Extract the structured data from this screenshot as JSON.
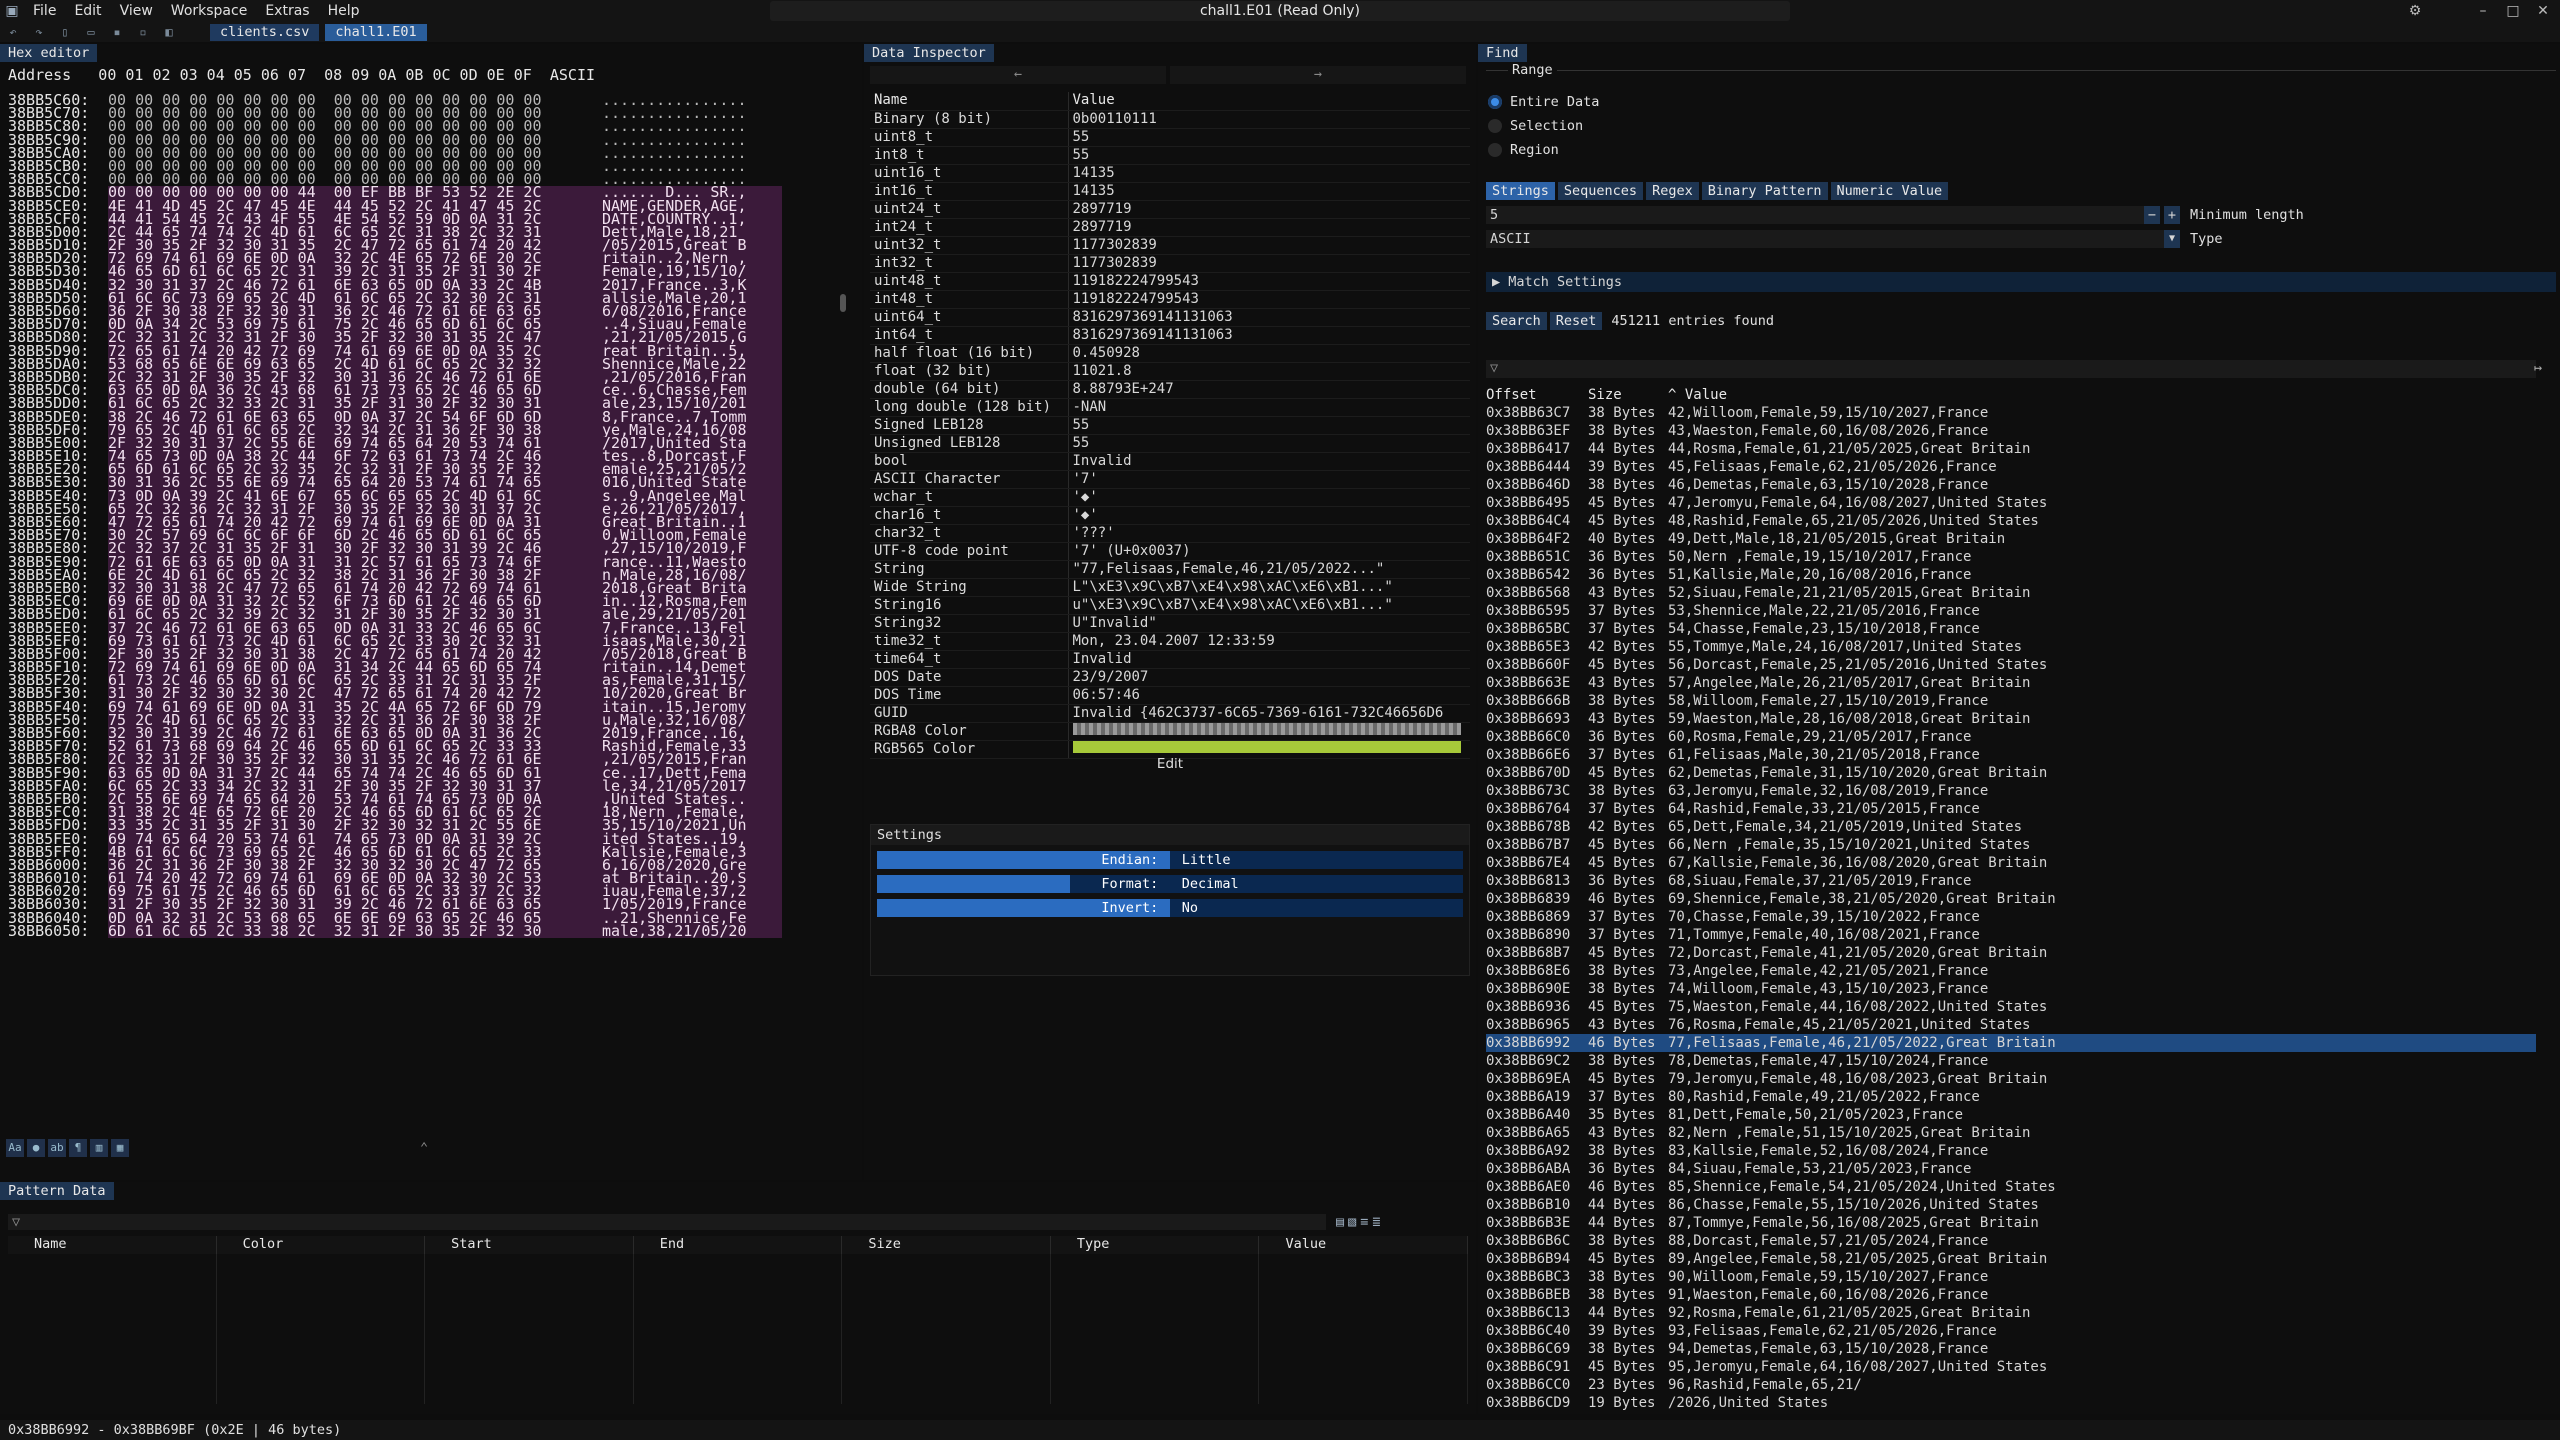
{
  "window": {
    "title": "chall1.E01 (Read Only)"
  },
  "menu": [
    "File",
    "Edit",
    "View",
    "Workspace",
    "Extras",
    "Help"
  ],
  "files": [
    "clients.csv",
    "chall1.E01"
  ],
  "hex_editor": {
    "tab": "Hex editor",
    "header": "Address   00 01 02 03 04 05 06 07  08 09 0A 0B 0C 0D 0E 0F  ASCII",
    "rows": [
      [
        "38BB5C60:",
        "00 00 00 00 00 00 00 00  00 00 00 00 00 00 00 00",
        "................"
      ],
      [
        "38BB5C70:",
        "00 00 00 00 00 00 00 00  00 00 00 00 00 00 00 00",
        "................"
      ],
      [
        "38BB5C80:",
        "00 00 00 00 00 00 00 00  00 00 00 00 00 00 00 00",
        "................"
      ],
      [
        "38BB5C90:",
        "00 00 00 00 00 00 00 00  00 00 00 00 00 00 00 00",
        "................"
      ],
      [
        "38BB5CA0:",
        "00 00 00 00 00 00 00 00  00 00 00 00 00 00 00 00",
        "................"
      ],
      [
        "38BB5CB0:",
        "00 00 00 00 00 00 00 00  00 00 00 00 00 00 00 00",
        "................"
      ],
      [
        "38BB5CC0:",
        "00 00 00 00 00 00 00 00  00 00 00 00 00 00 00 00",
        "................"
      ],
      [
        "38BB5CD0:",
        "00 00 00 00 00 00 00 44  00 EF BB BF 53 52 2E 2C",
        "...... D... SR.,"
      ],
      [
        "38BB5CE0:",
        "4E 41 4D 45 2C 47 45 4E  44 45 52 2C 41 47 45 2C",
        "NAME,GENDER,AGE,"
      ],
      [
        "38BB5CF0:",
        "44 41 54 45 2C 43 4F 55  4E 54 52 59 0D 0A 31 2C",
        "DATE,COUNTRY..1,"
      ],
      [
        "38BB5D00:",
        "2C 44 65 74 74 2C 4D 61  6C 65 2C 31 38 2C 32 31",
        "Dett,Male,18,21"
      ],
      [
        "38BB5D10:",
        "2F 30 35 2F 32 30 31 35  2C 47 72 65 61 74 20 42",
        "/05/2015,Great B"
      ],
      [
        "38BB5D20:",
        "72 69 74 61 69 6E 0D 0A  32 2C 4E 65 72 6E 20 2C",
        "ritain..2,Nern ,"
      ],
      [
        "38BB5D30:",
        "46 65 6D 61 6C 65 2C 31  39 2C 31 35 2F 31 30 2F",
        "Female,19,15/10/"
      ],
      [
        "38BB5D40:",
        "32 30 31 37 2C 46 72 61  6E 63 65 0D 0A 33 2C 4B",
        "2017,France..3,K"
      ],
      [
        "38BB5D50:",
        "61 6C 6C 73 69 65 2C 4D  61 6C 65 2C 32 30 2C 31",
        "allsie,Male,20,1"
      ],
      [
        "38BB5D60:",
        "36 2F 30 38 2F 32 30 31  36 2C 46 72 61 6E 63 65",
        "6/08/2016,France"
      ],
      [
        "38BB5D70:",
        "0D 0A 34 2C 53 69 75 61  75 2C 46 65 6D 61 6C 65",
        "..4,Siuau,Female"
      ],
      [
        "38BB5D80:",
        "2C 32 31 2C 32 31 2F 30  35 2F 32 30 31 35 2C 47",
        ",21,21/05/2015,G"
      ],
      [
        "38BB5D90:",
        "72 65 61 74 20 42 72 69  74 61 69 6E 0D 0A 35 2C",
        "reat Britain..5,"
      ],
      [
        "38BB5DA0:",
        "53 68 65 6E 6E 69 63 65  2C 4D 61 6C 65 2C 32 32",
        "Shennice,Male,22"
      ],
      [
        "38BB5DB0:",
        "2C 32 31 2F 30 35 2F 32  30 31 36 2C 46 72 61 6E",
        ",21/05/2016,Fran"
      ],
      [
        "38BB5DC0:",
        "63 65 0D 0A 36 2C 43 68  61 73 73 65 2C 46 65 6D",
        "ce..6,Chasse,Fem"
      ],
      [
        "38BB5DD0:",
        "61 6C 65 2C 32 33 2C 31  35 2F 31 30 2F 32 30 31",
        "ale,23,15/10/201"
      ],
      [
        "38BB5DE0:",
        "38 2C 46 72 61 6E 63 65  0D 0A 37 2C 54 6F 6D 6D",
        "8,France..7,Tomm"
      ],
      [
        "38BB5DF0:",
        "79 65 2C 4D 61 6C 65 2C  32 34 2C 31 36 2F 30 38",
        "ye,Male,24,16/08"
      ],
      [
        "38BB5E00:",
        "2F 32 30 31 37 2C 55 6E  69 74 65 64 20 53 74 61",
        "/2017,United Sta"
      ],
      [
        "38BB5E10:",
        "74 65 73 0D 0A 38 2C 44  6F 72 63 61 73 74 2C 46",
        "tes..8,Dorcast,F"
      ],
      [
        "38BB5E20:",
        "65 6D 61 6C 65 2C 32 35  2C 32 31 2F 30 35 2F 32",
        "emale,25,21/05/2"
      ],
      [
        "38BB5E30:",
        "30 31 36 2C 55 6E 69 74  65 64 20 53 74 61 74 65",
        "016,United State"
      ],
      [
        "38BB5E40:",
        "73 0D 0A 39 2C 41 6E 67  65 6C 65 65 2C 4D 61 6C",
        "s..9,Angelee,Mal"
      ],
      [
        "38BB5E50:",
        "65 2C 32 36 2C 32 31 2F  30 35 2F 32 30 31 37 2C",
        "e,26,21/05/2017,"
      ],
      [
        "38BB5E60:",
        "47 72 65 61 74 20 42 72  69 74 61 69 6E 0D 0A 31",
        "Great Britain..1"
      ],
      [
        "38BB5E70:",
        "30 2C 57 69 6C 6C 6F 6F  6D 2C 46 65 6D 61 6C 65",
        "0,Willoom,Female"
      ],
      [
        "38BB5E80:",
        "2C 32 37 2C 31 35 2F 31  30 2F 32 30 31 39 2C 46",
        ",27,15/10/2019,F"
      ],
      [
        "38BB5E90:",
        "72 61 6E 63 65 0D 0A 31  31 2C 57 61 65 73 74 6F",
        "rance..11,Waesto"
      ],
      [
        "38BB5EA0:",
        "6E 2C 4D 61 6C 65 2C 32  38 2C 31 36 2F 30 38 2F",
        "n,Male,28,16/08/"
      ],
      [
        "38BB5EB0:",
        "32 30 31 38 2C 47 72 65  61 74 20 42 72 69 74 61",
        "2018,Great Brita"
      ],
      [
        "38BB5EC0:",
        "69 6E 0D 0A 31 32 2C 52  6F 73 6D 61 2C 46 65 6D",
        "in..12,Rosma,Fem"
      ],
      [
        "38BB5ED0:",
        "61 6C 65 2C 32 39 2C 32  31 2F 30 35 2F 32 30 31",
        "ale,29,21/05/201"
      ],
      [
        "38BB5EE0:",
        "37 2C 46 72 61 6E 63 65  0D 0A 31 33 2C 46 65 6C",
        "7,France..13,Fel"
      ],
      [
        "38BB5EF0:",
        "69 73 61 61 73 2C 4D 61  6C 65 2C 33 30 2C 32 31",
        "isaas,Male,30,21"
      ],
      [
        "38BB5F00:",
        "2F 30 35 2F 32 30 31 38  2C 47 72 65 61 74 20 42",
        "/05/2018,Great B"
      ],
      [
        "38BB5F10:",
        "72 69 74 61 69 6E 0D 0A  31 34 2C 44 65 6D 65 74",
        "ritain..14,Demet"
      ],
      [
        "38BB5F20:",
        "61 73 2C 46 65 6D 61 6C  65 2C 33 31 2C 31 35 2F",
        "as,Female,31,15/"
      ],
      [
        "38BB5F30:",
        "31 30 2F 32 30 32 30 2C  47 72 65 61 74 20 42 72",
        "10/2020,Great Br"
      ],
      [
        "38BB5F40:",
        "69 74 61 69 6E 0D 0A 31  35 2C 4A 65 72 6F 6D 79",
        "itain..15,Jeromy"
      ],
      [
        "38BB5F50:",
        "75 2C 4D 61 6C 65 2C 33  32 2C 31 36 2F 30 38 2F",
        "u,Male,32,16/08/"
      ],
      [
        "38BB5F60:",
        "32 30 31 39 2C 46 72 61  6E 63 65 0D 0A 31 36 2C",
        "2019,France..16,"
      ],
      [
        "38BB5F70:",
        "52 61 73 68 69 64 2C 46  65 6D 61 6C 65 2C 33 33",
        "Rashid,Female,33"
      ],
      [
        "38BB5F80:",
        "2C 32 31 2F 30 35 2F 32  30 31 35 2C 46 72 61 6E",
        ",21/05/2015,Fran"
      ],
      [
        "38BB5F90:",
        "63 65 0D 0A 31 37 2C 44  65 74 74 2C 46 65 6D 61",
        "ce..17,Dett,Fema"
      ],
      [
        "38BB5FA0:",
        "6C 65 2C 33 34 2C 32 31  2F 30 35 2F 32 30 31 37",
        "le,34,21/05/2017"
      ],
      [
        "38BB5FB0:",
        "2C 55 6E 69 74 65 64 20  53 74 61 74 65 73 0D 0A",
        ",United States.."
      ],
      [
        "38BB5FC0:",
        "31 38 2C 4E 65 72 6E 20  2C 46 65 6D 61 6C 65 2C",
        "18,Nern ,Female,"
      ],
      [
        "38BB5FD0:",
        "33 35 2C 31 35 2F 31 30  2F 32 30 32 31 2C 55 6E",
        "35,15/10/2021,Un"
      ],
      [
        "38BB5FE0:",
        "69 74 65 64 20 53 74 61  74 65 73 0D 0A 31 39 2C",
        "ited States..19,"
      ],
      [
        "38BB5FF0:",
        "4B 61 6C 6C 73 69 65 2C  46 65 6D 61 6C 65 2C 33",
        "Kallsie,Female,3"
      ],
      [
        "38BB6000:",
        "36 2C 31 36 2F 30 38 2F  32 30 32 30 2C 47 72 65",
        "6,16/08/2020,Gre"
      ],
      [
        "38BB6010:",
        "61 74 20 42 72 69 74 61  69 6E 0D 0A 32 30 2C 53",
        "at Britain..20,S"
      ],
      [
        "38BB6020:",
        "69 75 61 75 2C 46 65 6D  61 6C 65 2C 33 37 2C 32",
        "iuau,Female,37,2"
      ],
      [
        "38BB6030:",
        "31 2F 30 35 2F 32 30 31  39 2C 46 72 61 6E 63 65",
        "1/05/2019,France"
      ],
      [
        "38BB6040:",
        "0D 0A 32 31 2C 53 68 65  6E 6E 69 63 65 2C 46 65",
        "..21,Shennice,Fe"
      ],
      [
        "38BB6050:",
        "6D 61 6C 65 2C 33 38 2C  32 31 2F 30 35 2F 32 30",
        "male,38,21/05/20"
      ]
    ]
  },
  "data_inspector": {
    "tab": "Data Inspector",
    "nav": [
      "←",
      "→"
    ],
    "header": [
      "Name",
      "Value"
    ],
    "rows": [
      [
        "Binary (8 bit)",
        "0b00110111"
      ],
      [
        "uint8_t",
        "55"
      ],
      [
        "int8_t",
        "55"
      ],
      [
        "uint16_t",
        "14135"
      ],
      [
        "int16_t",
        "14135"
      ],
      [
        "uint24_t",
        "2897719"
      ],
      [
        "int24_t",
        "2897719"
      ],
      [
        "uint32_t",
        "1177302839"
      ],
      [
        "int32_t",
        "1177302839"
      ],
      [
        "uint48_t",
        "119182224799543"
      ],
      [
        "int48_t",
        "119182224799543"
      ],
      [
        "uint64_t",
        "8316297369141131063"
      ],
      [
        "int64_t",
        "8316297369141131063"
      ],
      [
        "half float (16 bit)",
        "0.450928"
      ],
      [
        "float (32 bit)",
        "11021.8"
      ],
      [
        "double (64 bit)",
        "8.88793E+247"
      ],
      [
        "long double (128 bit)",
        "-NAN"
      ],
      [
        "Signed LEB128",
        "55"
      ],
      [
        "Unsigned LEB128",
        "55"
      ],
      [
        "bool",
        "Invalid"
      ],
      [
        "ASCII Character",
        "'7'"
      ],
      [
        "wchar_t",
        "'◆'"
      ],
      [
        "char16_t",
        "'◆'"
      ],
      [
        "char32_t",
        "'???'"
      ],
      [
        "UTF-8 code point",
        "'7' (U+0x0037)"
      ],
      [
        "String",
        "\"77,Felisaas,Female,46,21/05/2022...\""
      ],
      [
        "Wide String",
        "L\"\\xE3\\x9C\\xB7\\xE4\\x98\\xAC\\xE6\\xB1...\""
      ],
      [
        "String16",
        "u\"\\xE3\\x9C\\xB7\\xE4\\x98\\xAC\\xE6\\xB1...\""
      ],
      [
        "String32",
        "U\"Invalid\""
      ],
      [
        "time32_t",
        "Mon, 23.04.2007 12:33:59"
      ],
      [
        "time64_t",
        "Invalid"
      ],
      [
        "DOS Date",
        "23/9/2007"
      ],
      [
        "DOS Time",
        "06:57:46"
      ],
      [
        "GUID",
        "Invalid {462C3737-6C65-7369-6161-732C46656D6"
      ],
      [
        "RGBA8 Color",
        ""
      ],
      [
        "RGB565 Color",
        ""
      ]
    ],
    "edit": "Edit",
    "settings": {
      "title": "Settings",
      "rows": [
        {
          "label": "Endian:",
          "value": "Little",
          "fill": 0.5
        },
        {
          "label": "Format:",
          "value": "Decimal",
          "fill": 0.33
        },
        {
          "label": "Invert:",
          "value": "No",
          "fill": 0.5
        }
      ]
    }
  },
  "find": {
    "tab": "Find",
    "range_label": "Range",
    "range_options": [
      {
        "label": "Entire Data",
        "selected": true
      },
      {
        "label": "Selection",
        "selected": false
      },
      {
        "label": "Region",
        "selected": false
      }
    ],
    "subtabs": [
      "Strings",
      "Sequences",
      "Regex",
      "Binary Pattern",
      "Numeric Value"
    ],
    "min_length": "5",
    "min_length_label": "Minimum length",
    "type_value": "ASCII",
    "type_label": "Type",
    "match_settings": "Match Settings",
    "search_btn": "Search",
    "reset_btn": "Reset",
    "count": "451211 entries found",
    "header": [
      "Offset",
      "Size",
      "Value"
    ],
    "rows": [
      [
        "0x38BB63C7",
        "38 Bytes",
        "42,Willoom,Female,59,15/10/2027,France"
      ],
      [
        "0x38BB63EF",
        "38 Bytes",
        "43,Waeston,Female,60,16/08/2026,France"
      ],
      [
        "0x38BB6417",
        "44 Bytes",
        "44,Rosma,Female,61,21/05/2025,Great Britain"
      ],
      [
        "0x38BB6444",
        "39 Bytes",
        "45,Felisaas,Female,62,21/05/2026,France"
      ],
      [
        "0x38BB646D",
        "38 Bytes",
        "46,Demetas,Female,63,15/10/2028,France"
      ],
      [
        "0x38BB6495",
        "45 Bytes",
        "47,Jeromyu,Female,64,16/08/2027,United States"
      ],
      [
        "0x38BB64C4",
        "45 Bytes",
        "48,Rashid,Female,65,21/05/2026,United States"
      ],
      [
        "0x38BB64F2",
        "40 Bytes",
        "49,Dett,Male,18,21/05/2015,Great Britain"
      ],
      [
        "0x38BB651C",
        "36 Bytes",
        "50,Nern ,Female,19,15/10/2017,France"
      ],
      [
        "0x38BB6542",
        "36 Bytes",
        "51,Kallsie,Male,20,16/08/2016,France"
      ],
      [
        "0x38BB6568",
        "43 Bytes",
        "52,Siuau,Female,21,21/05/2015,Great Britain"
      ],
      [
        "0x38BB6595",
        "37 Bytes",
        "53,Shennice,Male,22,21/05/2016,France"
      ],
      [
        "0x38BB65BC",
        "37 Bytes",
        "54,Chasse,Female,23,15/10/2018,France"
      ],
      [
        "0x38BB65E3",
        "42 Bytes",
        "55,Tommye,Male,24,16/08/2017,United States"
      ],
      [
        "0x38BB660F",
        "45 Bytes",
        "56,Dorcast,Female,25,21/05/2016,United States"
      ],
      [
        "0x38BB663E",
        "43 Bytes",
        "57,Angelee,Male,26,21/05/2017,Great Britain"
      ],
      [
        "0x38BB666B",
        "38 Bytes",
        "58,Willoom,Female,27,15/10/2019,France"
      ],
      [
        "0x38BB6693",
        "43 Bytes",
        "59,Waeston,Male,28,16/08/2018,Great Britain"
      ],
      [
        "0x38BB66C0",
        "36 Bytes",
        "60,Rosma,Female,29,21/05/2017,France"
      ],
      [
        "0x38BB66E6",
        "37 Bytes",
        "61,Felisaas,Male,30,21/05/2018,France"
      ],
      [
        "0x38BB670D",
        "45 Bytes",
        "62,Demetas,Female,31,15/10/2020,Great Britain"
      ],
      [
        "0x38BB673C",
        "38 Bytes",
        "63,Jeromyu,Female,32,16/08/2019,France"
      ],
      [
        "0x38BB6764",
        "37 Bytes",
        "64,Rashid,Female,33,21/05/2015,France"
      ],
      [
        "0x38BB678B",
        "42 Bytes",
        "65,Dett,Female,34,21/05/2019,United States"
      ],
      [
        "0x38BB67B7",
        "45 Bytes",
        "66,Nern ,Female,35,15/10/2021,United States"
      ],
      [
        "0x38BB67E4",
        "45 Bytes",
        "67,Kallsie,Female,36,16/08/2020,Great Britain"
      ],
      [
        "0x38BB6813",
        "36 Bytes",
        "68,Siuau,Female,37,21/05/2019,France"
      ],
      [
        "0x38BB6839",
        "46 Bytes",
        "69,Shennice,Female,38,21/05/2020,Great Britain"
      ],
      [
        "0x38BB6869",
        "37 Bytes",
        "70,Chasse,Female,39,15/10/2022,France"
      ],
      [
        "0x38BB6890",
        "37 Bytes",
        "71,Tommye,Female,40,16/08/2021,France"
      ],
      [
        "0x38BB68B7",
        "45 Bytes",
        "72,Dorcast,Female,41,21/05/2020,Great Britain"
      ],
      [
        "0x38BB68E6",
        "38 Bytes",
        "73,Angelee,Female,42,21/05/2021,France"
      ],
      [
        "0x38BB690E",
        "38 Bytes",
        "74,Willoom,Female,43,15/10/2023,France"
      ],
      [
        "0x38BB6936",
        "45 Bytes",
        "75,Waeston,Female,44,16/08/2022,United States"
      ],
      [
        "0x38BB6965",
        "43 Bytes",
        "76,Rosma,Female,45,21/05/2021,United States"
      ],
      [
        "0x38BB6992",
        "46 Bytes",
        "77,Felisaas,Female,46,21/05/2022,Great Britain"
      ],
      [
        "0x38BB69C2",
        "38 Bytes",
        "78,Demetas,Female,47,15/10/2024,France"
      ],
      [
        "0x38BB69EA",
        "45 Bytes",
        "79,Jeromyu,Female,48,16/08/2023,Great Britain"
      ],
      [
        "0x38BB6A19",
        "37 Bytes",
        "80,Rashid,Female,49,21/05/2022,France"
      ],
      [
        "0x38BB6A40",
        "35 Bytes",
        "81,Dett,Female,50,21/05/2023,France"
      ],
      [
        "0x38BB6A65",
        "43 Bytes",
        "82,Nern ,Female,51,15/10/2025,Great Britain"
      ],
      [
        "0x38BB6A92",
        "38 Bytes",
        "83,Kallsie,Female,52,16/08/2024,France"
      ],
      [
        "0x38BB6ABA",
        "36 Bytes",
        "84,Siuau,Female,53,21/05/2023,France"
      ],
      [
        "0x38BB6AE0",
        "46 Bytes",
        "85,Shennice,Female,54,21/05/2024,United States"
      ],
      [
        "0x38BB6B10",
        "44 Bytes",
        "86,Chasse,Female,55,15/10/2026,United States"
      ],
      [
        "0x38BB6B3E",
        "44 Bytes",
        "87,Tommye,Female,56,16/08/2025,Great Britain"
      ],
      [
        "0x38BB6B6C",
        "38 Bytes",
        "88,Dorcast,Female,57,21/05/2024,France"
      ],
      [
        "0x38BB6B94",
        "45 Bytes",
        "89,Angelee,Female,58,21/05/2025,Great Britain"
      ],
      [
        "0x38BB6BC3",
        "38 Bytes",
        "90,Willoom,Female,59,15/10/2027,France"
      ],
      [
        "0x38BB6BEB",
        "38 Bytes",
        "91,Waeston,Female,60,16/08/2026,France"
      ],
      [
        "0x38BB6C13",
        "44 Bytes",
        "92,Rosma,Female,61,21/05/2025,Great Britain"
      ],
      [
        "0x38BB6C40",
        "39 Bytes",
        "93,Felisaas,Female,62,21/05/2026,France"
      ],
      [
        "0x38BB6C69",
        "38 Bytes",
        "94,Demetas,Female,63,15/10/2028,France"
      ],
      [
        "0x38BB6C91",
        "45 Bytes",
        "95,Jeromyu,Female,64,16/08/2027,United States"
      ],
      [
        "0x38BB6CC0",
        "23 Bytes",
        "96,Rashid,Female,65,21/"
      ],
      [
        "0x38BB6CD9",
        "19 Bytes",
        "/2026,United States"
      ]
    ]
  },
  "pattern_data": {
    "tab": "Pattern Data",
    "header": [
      "Name",
      "Color",
      "Start",
      "End",
      "Size",
      "Type",
      "Value"
    ]
  },
  "status": "0x38BB6992 - 0x38BB69BF (0x2E | 46 bytes)"
}
